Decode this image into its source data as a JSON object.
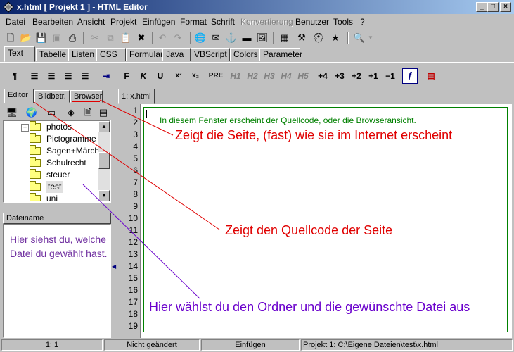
{
  "window": {
    "title": "x.html  [ Projekt 1 ] - HTML Editor"
  },
  "menu": [
    "Datei",
    "Bearbeiten",
    "Ansicht",
    "Projekt",
    "Einfügen",
    "Format",
    "Schrift",
    "Konvertierung",
    "Benutzer",
    "Tools",
    "?"
  ],
  "tabs": [
    "Text",
    "Tabelle",
    "Listen",
    "CSS",
    "Formular",
    "Java",
    "VBScript",
    "Colors",
    "Parameter"
  ],
  "format_toolbar": {
    "bold": "F",
    "italic": "K",
    "underline": "U",
    "sup": "x²",
    "sub": "x₂",
    "pre": "PRE",
    "h1": "H1",
    "h2": "H2",
    "h3": "H3",
    "h4": "H4",
    "h5": "H5",
    "p4": "+4",
    "p3": "+3",
    "p2": "+2",
    "p1": "+1",
    "m1": "−1"
  },
  "left_tabs": [
    "Editor",
    "Bildbetr.",
    "Browser"
  ],
  "folders": [
    {
      "name": "photos",
      "expander": "+"
    },
    {
      "name": "Pictogramme",
      "expander": ""
    },
    {
      "name": "Sagen+Märchen",
      "expander": ""
    },
    {
      "name": "Schulrecht",
      "expander": ""
    },
    {
      "name": "steuer",
      "expander": ""
    },
    {
      "name": "test",
      "expander": ""
    },
    {
      "name": "uni",
      "expander": ""
    }
  ],
  "file_panel": {
    "header": "Dateiname",
    "hint": "Hier siehst du, welche Datei du gewählt hast."
  },
  "editor": {
    "tab": "1: x.html",
    "text": "In diesem Fenster erscheint der Quellcode, oder die Browseransicht.",
    "line_numbers": [
      "1",
      "2",
      "3",
      "4",
      "5",
      "6",
      "7",
      "8",
      "9",
      "10",
      "11",
      "12",
      "13",
      "14",
      "15",
      "16",
      "17",
      "18",
      "19"
    ]
  },
  "annotations": {
    "browser": "Zeigt die Seite, (fast) wie sie im Internet erscheint",
    "editor": "Zeigt den Quellcode der Seite",
    "folder": "Hier wählst du den Ordner und die gewünschte Datei aus"
  },
  "status": {
    "position": "1: 1",
    "modified": "Nicht geändert",
    "mode": "Einfügen",
    "path": "Projekt 1: C:\\Eigene Dateien\\test\\x.html"
  },
  "colors": {
    "annot_red": "#e00000",
    "annot_purple": "#6a00cc",
    "editor_text": "#008000"
  }
}
